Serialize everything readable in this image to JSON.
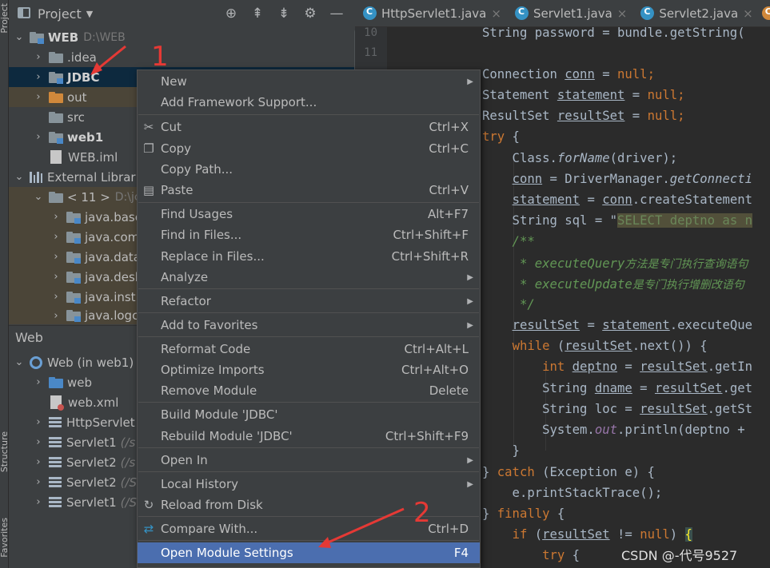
{
  "sidebar_strip": {
    "project_label": "Project",
    "structure_label": "Structure",
    "favorites_label": "Favorites"
  },
  "project_panel": {
    "title": "Project",
    "header_icons": [
      "crosshair-icon",
      "expand-all-icon",
      "collapse-all-icon",
      "gear-icon",
      "minimize-icon"
    ],
    "tree": [
      {
        "label": "WEB",
        "path": "D:\\WEB"
      },
      {
        "label": ".idea"
      },
      {
        "label": "JDBC"
      },
      {
        "label": "out"
      },
      {
        "label": "src"
      },
      {
        "label": "web1"
      },
      {
        "label": "WEB.iml"
      },
      {
        "label": "External Librar"
      },
      {
        "label": "< 11 >",
        "path": "D:\\jc"
      },
      {
        "label": "java.base"
      },
      {
        "label": "java.com"
      },
      {
        "label": "java.data"
      },
      {
        "label": "java.desk"
      },
      {
        "label": "java.instr"
      },
      {
        "label": "java.logc"
      }
    ]
  },
  "web_panel": {
    "title": "Web",
    "tree": [
      {
        "label": "Web (in web1)"
      },
      {
        "label": "web"
      },
      {
        "label": "web.xml"
      },
      {
        "label": "HttpServlet"
      },
      {
        "label": "Servlet1",
        "hint": "(/s"
      },
      {
        "label": "Servlet2",
        "hint": "(/s"
      },
      {
        "label": "Servlet2",
        "hint": "(/S"
      },
      {
        "label": "Servlet1",
        "hint": "(/S"
      }
    ]
  },
  "editor_tabs": [
    {
      "label": "HttpServlet1.java",
      "close": "×"
    },
    {
      "label": "Servlet1.java",
      "close": "×"
    },
    {
      "label": "Servlet2.java",
      "close": "×"
    }
  ],
  "gutter": {
    "line_10": "10",
    "line_11": "11"
  },
  "code": {
    "l0": "String password = bundle.getString(",
    "l2a": "Connection ",
    "l2b": "conn",
    "l2c": " = ",
    "l2d": "null",
    "l2e": ";",
    "l3a": "Statement ",
    "l3b": "statement",
    "l3c": " = ",
    "l3d": "null",
    "l3e": ";",
    "l4a": "ResultSet ",
    "l4b": "resultSet",
    "l4c": " = ",
    "l4d": "null",
    "l4e": ";",
    "l5a": "try",
    "l5b": " {",
    "l6a": "    Class.",
    "l6b": "forName",
    "l6c": "(driver);",
    "l7a": "    ",
    "l7b": "conn",
    "l7c": " = DriverManager.",
    "l7d": "getConnecti",
    "l8a": "    ",
    "l8b": "statement",
    "l8c": " = ",
    "l8d": "conn",
    "l8e": ".createStatement",
    "l9a": "    String sql = \"",
    "l9b": "SELECT deptno as n",
    "l10": "    /**",
    "l11a": "     * executeQuery",
    "l11b": "方法是专门执行查询语句",
    "l12a": "     * executeUpdate",
    "l12b": "是专门执行增删改语句",
    "l13": "     */",
    "l14a": "    ",
    "l14b": "resultSet",
    "l14c": " = ",
    "l14d": "statement",
    "l14e": ".executeQue",
    "l15a": "    ",
    "l15b": "while",
    "l15c": " (",
    "l15d": "resultSet",
    "l15e": ".next()) {",
    "l16a": "        ",
    "l16b": "int ",
    "l16c": "deptno",
    "l16d": " = ",
    "l16e": "resultSet",
    "l16f": ".getIn",
    "l17a": "        String ",
    "l17b": "dname",
    "l17c": " = ",
    "l17d": "resultSet",
    "l17e": ".get",
    "l18a": "        String ",
    "l18b": "loc",
    "l18c": " = ",
    "l18d": "resultSet",
    "l18e": ".getSt",
    "l19a": "        System.",
    "l19b": "out",
    "l19c": ".println(deptno + ",
    "l20": "    }",
    "l21a": "} ",
    "l21b": "catch",
    "l21c": " (Exception e) {",
    "l22": "    e.printStackTrace();",
    "l23a": "} ",
    "l23b": "finally",
    "l23c": " {",
    "l24a": "    ",
    "l24b": "if",
    "l24c": " (",
    "l24d": "resultSet",
    "l24e": " != ",
    "l24f": "null",
    "l24g": ") ",
    "l24h": "{",
    "l25a": "        ",
    "l25b": "try",
    "l25c": " {"
  },
  "context_menu": {
    "items": [
      {
        "label": "New",
        "shortcut": "",
        "submenu": true
      },
      {
        "label": "Add Framework Support...",
        "shortcut": ""
      },
      {
        "label": "Cut",
        "shortcut": "Ctrl+X",
        "icon": "scissors-icon"
      },
      {
        "label": "Copy",
        "shortcut": "Ctrl+C",
        "icon": "copy-icon"
      },
      {
        "label": "Copy Path...",
        "shortcut": ""
      },
      {
        "label": "Paste",
        "shortcut": "Ctrl+V",
        "icon": "clipboard-icon"
      },
      {
        "label": "Find Usages",
        "shortcut": "Alt+F7"
      },
      {
        "label": "Find in Files...",
        "shortcut": "Ctrl+Shift+F"
      },
      {
        "label": "Replace in Files...",
        "shortcut": "Ctrl+Shift+R"
      },
      {
        "label": "Analyze",
        "shortcut": "",
        "submenu": true
      },
      {
        "label": "Refactor",
        "shortcut": "",
        "submenu": true
      },
      {
        "label": "Add to Favorites",
        "shortcut": "",
        "submenu": true
      },
      {
        "label": "Reformat Code",
        "shortcut": "Ctrl+Alt+L"
      },
      {
        "label": "Optimize Imports",
        "shortcut": "Ctrl+Alt+O"
      },
      {
        "label": "Remove Module",
        "shortcut": "Delete"
      },
      {
        "label": "Build Module 'JDBC'",
        "shortcut": ""
      },
      {
        "label": "Rebuild Module 'JDBC'",
        "shortcut": "Ctrl+Shift+F9"
      },
      {
        "label": "Open In",
        "shortcut": "",
        "submenu": true
      },
      {
        "label": "Local History",
        "shortcut": "",
        "submenu": true
      },
      {
        "label": "Reload from Disk",
        "shortcut": "",
        "icon": "reload-icon"
      },
      {
        "label": "Compare With...",
        "shortcut": "Ctrl+D",
        "icon": "compare-icon"
      },
      {
        "label": "Open Module Settings",
        "shortcut": "F4",
        "selected": true
      }
    ]
  },
  "annotations": {
    "step1": "1",
    "step2": "2"
  },
  "watermark": "CSDN @-代号9527",
  "colors": {
    "menu_selection": "#4b6eaf",
    "annotation": "#e53935",
    "selected_row": "#0d293e"
  }
}
